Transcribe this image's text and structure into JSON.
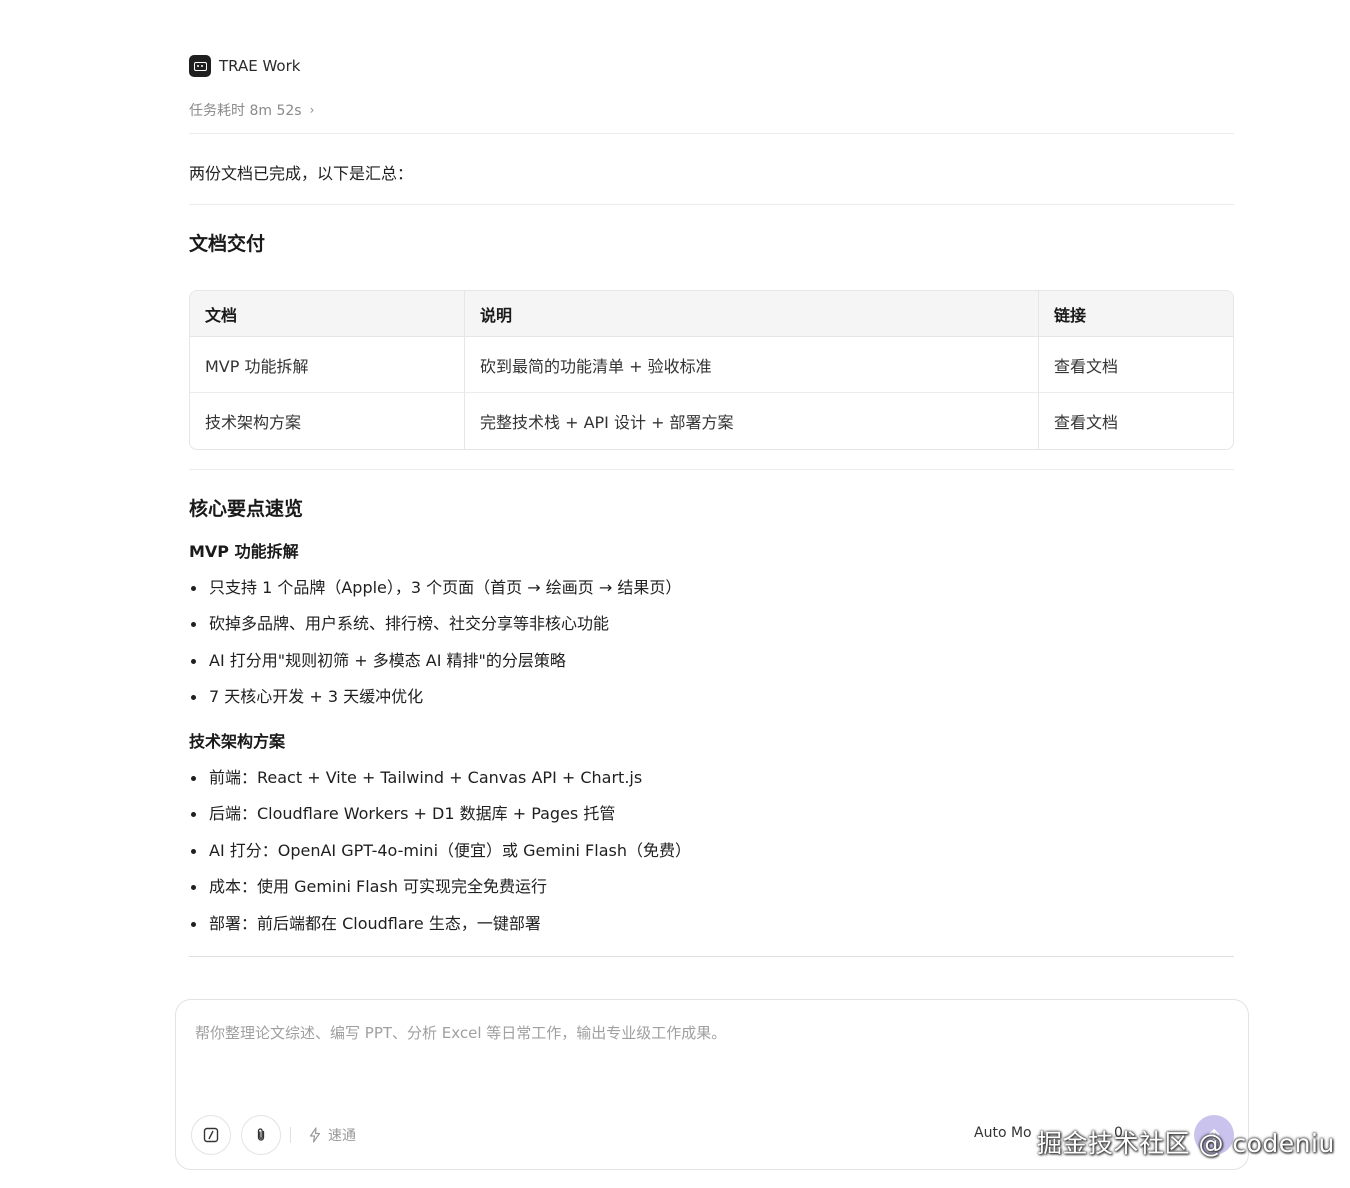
{
  "agent": {
    "name": "TRAE Work"
  },
  "task": {
    "duration_label": "任务耗时 8m 52s"
  },
  "summary": "两份文档已完成，以下是汇总：",
  "delivery": {
    "title": "文档交付",
    "table": {
      "headers": [
        "文档",
        "说明",
        "链接"
      ],
      "rows": [
        {
          "doc": "MVP 功能拆解",
          "desc": "砍到最简的功能清单 + 验收标准",
          "link": "查看文档"
        },
        {
          "doc": "技术架构方案",
          "desc": "完整技术栈 + API 设计 + 部署方案",
          "link": "查看文档"
        }
      ]
    }
  },
  "highlights": {
    "title": "核心要点速览",
    "mvp": {
      "title": "MVP 功能拆解",
      "items": [
        "只支持 1 个品牌（Apple），3 个页面（首页 → 绘画页 → 结果页）",
        "砍掉多品牌、用户系统、排行榜、社交分享等非核心功能",
        "AI 打分用\"规则初筛 + 多模态 AI 精排\"的分层策略",
        "7 天核心开发 + 3 天缓冲优化"
      ]
    },
    "arch": {
      "title": "技术架构方案",
      "items": [
        "前端：React + Vite + Tailwind + Canvas API + Chart.js",
        "后端：Cloudflare Workers + D1 数据库 + Pages 托管",
        "AI 打分：OpenAI GPT-4o-mini（便宜）或 Gemini Flash（免费）",
        "成本：使用 Gemini Flash 可实现完全免费运行",
        "部署：前后端都在 Cloudflare 生态，一键部署"
      ]
    }
  },
  "composer": {
    "placeholder": "帮你整理论文综述、编写 PPT、分析 Excel 等日常工作，输出专业级工作成果。",
    "speed_label": "速通",
    "mode_label": "Auto Mo",
    "credit": "0"
  },
  "watermark": "掘金技术社区 @ codeniu",
  "icons": {
    "agent_logo": "trae-logo-icon",
    "chevron": "chevron-right-icon",
    "slash": "slash-command-icon",
    "attach": "paperclip-icon",
    "speed": "lightning-icon",
    "send": "arrow-up-icon"
  },
  "colors": {
    "send_button": "#c9c3ee",
    "muted_text": "#8a8a8a"
  }
}
